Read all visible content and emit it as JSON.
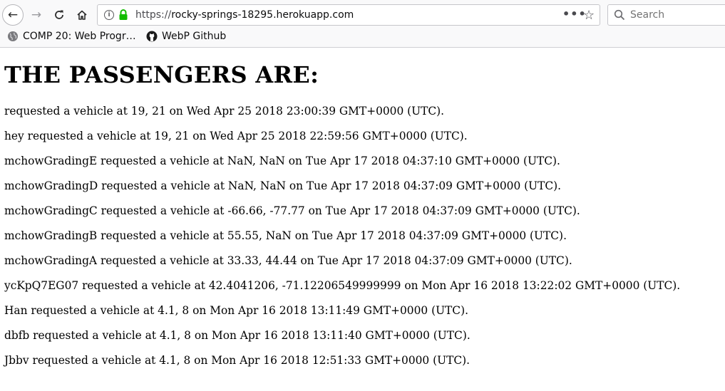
{
  "browser": {
    "url_prefix": "https://",
    "url_host": "rocky-springs-18295.herokuapp.com",
    "search_placeholder": "Search",
    "bookmarks": [
      {
        "label": "COMP 20: Web Progr…"
      },
      {
        "label": "WebP Github"
      }
    ]
  },
  "page": {
    "heading": "THE PASSENGERS ARE:",
    "passengers": [
      "requested a vehicle at 19, 21 on Wed Apr 25 2018 23:00:39 GMT+0000 (UTC).",
      "hey requested a vehicle at 19, 21 on Wed Apr 25 2018 22:59:56 GMT+0000 (UTC).",
      "mchowGradingE requested a vehicle at NaN, NaN on Tue Apr 17 2018 04:37:10 GMT+0000 (UTC).",
      "mchowGradingD requested a vehicle at NaN, NaN on Tue Apr 17 2018 04:37:09 GMT+0000 (UTC).",
      "mchowGradingC requested a vehicle at -66.66, -77.77 on Tue Apr 17 2018 04:37:09 GMT+0000 (UTC).",
      "mchowGradingB requested a vehicle at 55.55, NaN on Tue Apr 17 2018 04:37:09 GMT+0000 (UTC).",
      "mchowGradingA requested a vehicle at 33.33, 44.44 on Tue Apr 17 2018 04:37:09 GMT+0000 (UTC).",
      "ycKpQ7EG07 requested a vehicle at 42.4041206, -71.12206549999999 on Mon Apr 16 2018 13:22:02 GMT+0000 (UTC).",
      "Han requested a vehicle at 4.1, 8 on Mon Apr 16 2018 13:11:49 GMT+0000 (UTC).",
      "dbfb requested a vehicle at 4.1, 8 on Mon Apr 16 2018 13:11:40 GMT+0000 (UTC).",
      "Jbbv requested a vehicle at 4.1, 8 on Mon Apr 16 2018 12:51:33 GMT+0000 (UTC)."
    ]
  }
}
